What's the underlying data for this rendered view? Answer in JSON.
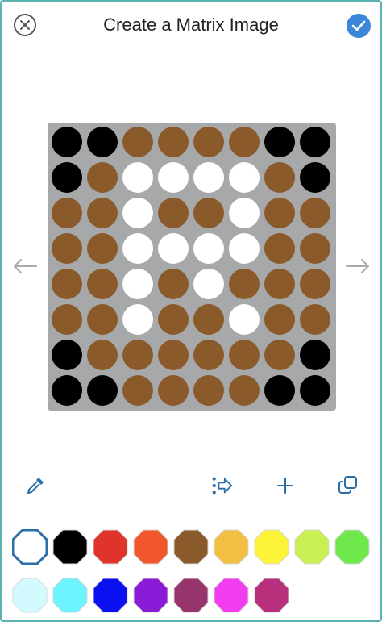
{
  "header": {
    "title": "Create a Matrix Image",
    "close_icon": "close-circle-icon",
    "confirm_icon": "checkmark-circle-icon",
    "accent": "#3a86d8"
  },
  "navigation": {
    "prev_icon": "arrow-left-icon",
    "next_icon": "arrow-right-icon"
  },
  "matrix": {
    "background": "#a7a8aa",
    "palette": {
      "K": "#000000",
      "B": "#8a5a2b",
      "W": "#ffffff"
    },
    "rows": [
      "KKBBBBKK",
      "KBWWWWBK",
      "BBWBBWBB",
      "BBWWWWBB",
      "BBWBWBBB",
      "BBWBBWBB",
      "KBBBBBBK",
      "KKBBBBKK"
    ]
  },
  "toolbar": {
    "eyedropper_icon": "eyedropper-icon",
    "shift_icon": "shift-right-icon",
    "add_icon": "plus-icon",
    "duplicate_icon": "duplicate-icon"
  },
  "palette": {
    "selected_index": 0,
    "selected_border": "#2a6fa8",
    "colors": [
      "#ffffff",
      "#000000",
      "#e0332a",
      "#f0582c",
      "#8a5a2b",
      "#f2bf42",
      "#fdf43a",
      "#c9f052",
      "#6ee84a",
      "#d2faff",
      "#6ef4ff",
      "#0a10f0",
      "#8a1ad6",
      "#98346c",
      "#f23cf0",
      "#b8307c"
    ]
  }
}
